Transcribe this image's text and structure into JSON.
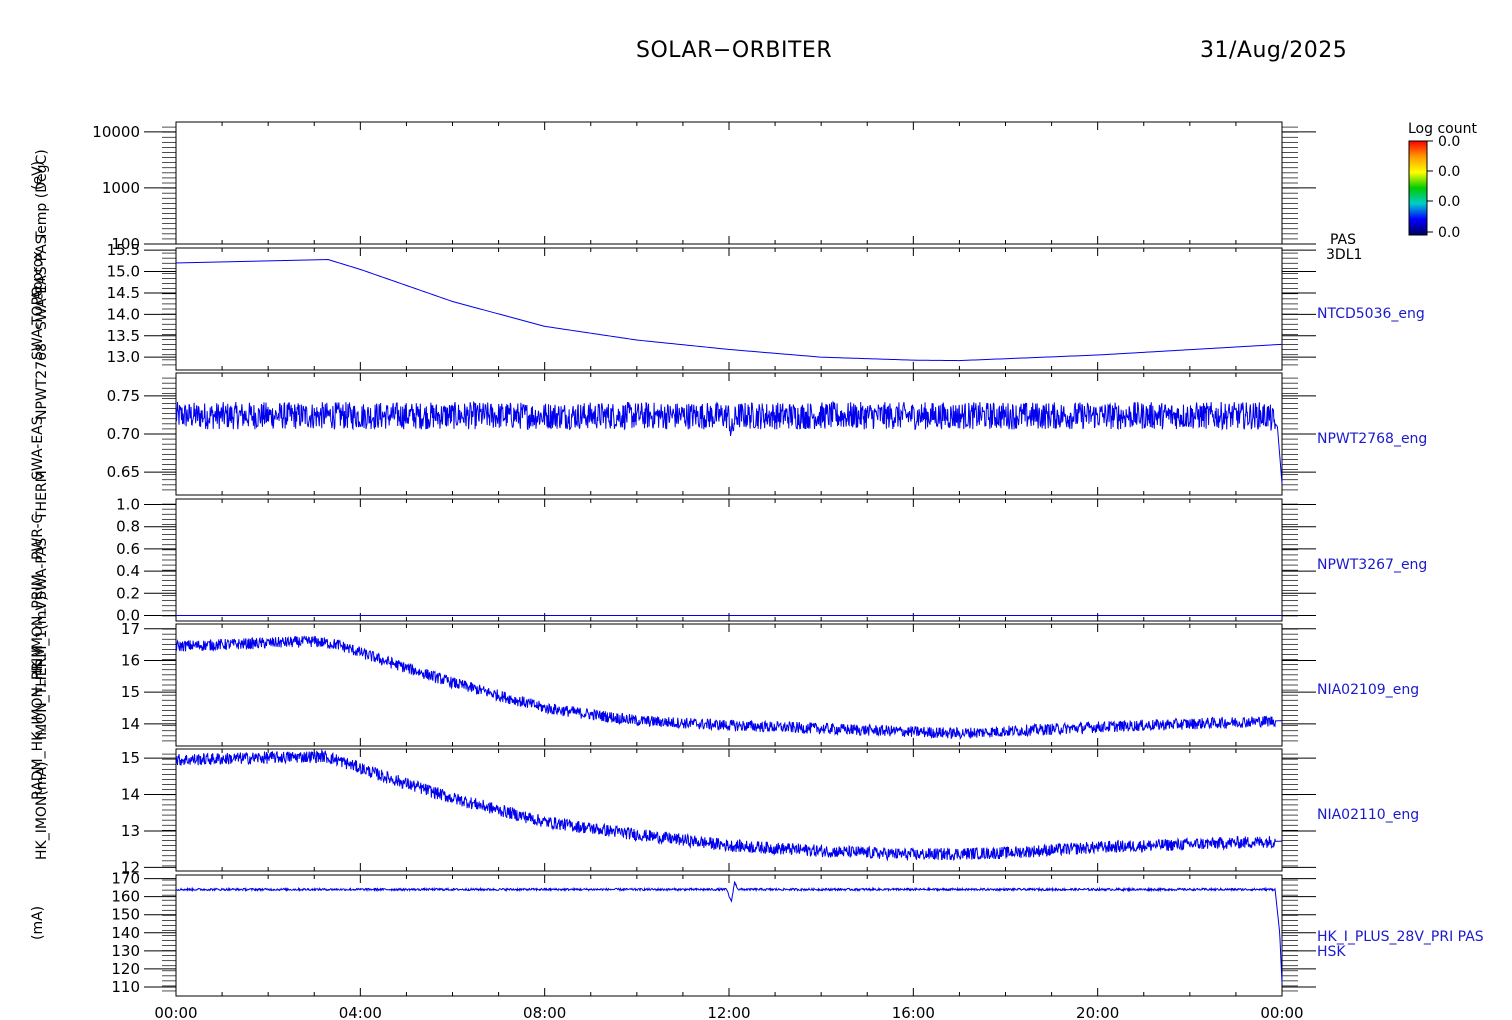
{
  "header": {
    "mission": "SOLAR−ORBITER",
    "date": "31/Aug/2025"
  },
  "y_axis_titles": [
    "(eV)",
    "Temp (DegC)",
    "Approx",
    "SWA-EAS-PAS",
    "SWA-TOPO",
    "NPWT2768",
    "SWA-EAS",
    "THERM",
    "PWR-C",
    "SWA-PAS",
    "HK_IMON_PRIM",
    "IMON_THERM_1(mV)",
    "RADM_HK_IMON_PRIM",
    "HK_IMON(mA)",
    "(mA)"
  ],
  "colorbar": {
    "title": "Log count",
    "ticks": [
      "0.0",
      "0.0",
      "0.0",
      "0.0"
    ],
    "colors": [
      "#ff0000",
      "#ff9900",
      "#ffff00",
      "#00cc00",
      "#00cccc",
      "#0000ff",
      "#000060"
    ]
  },
  "line_color": "#0000ee",
  "chart_data": {
    "type": "line",
    "x_ticks": [
      "00:00",
      "04:00",
      "08:00",
      "12:00",
      "16:00",
      "20:00",
      "00:00"
    ],
    "x_range_hours": [
      0,
      24
    ],
    "panels": [
      {
        "name": "PAS 3DL1",
        "label_lines": [
          "PAS",
          "3DL1"
        ],
        "type": "heatmap",
        "scale": "log",
        "ylim": [
          100,
          15000
        ],
        "yticks": [
          100,
          1000,
          10000
        ],
        "ytick_labels": [
          "100",
          "1000",
          "10000"
        ],
        "points": []
      },
      {
        "name": "NTCD5036_eng",
        "label_lines": [
          "NTCD5036_eng"
        ],
        "ylim": [
          12.7,
          15.55
        ],
        "yticks": [
          13.0,
          13.5,
          14.0,
          14.5,
          15.0,
          15.5
        ],
        "ytick_labels": [
          "13.0",
          "13.5",
          "14.0",
          "14.5",
          "15.0",
          "15.5"
        ],
        "noise": 0,
        "points": [
          [
            0,
            15.2
          ],
          [
            3.3,
            15.28
          ],
          [
            4,
            15.05
          ],
          [
            6,
            14.3
          ],
          [
            8,
            13.72
          ],
          [
            10,
            13.4
          ],
          [
            12,
            13.18
          ],
          [
            14,
            13.0
          ],
          [
            16,
            12.93
          ],
          [
            17,
            12.92
          ],
          [
            20,
            13.05
          ],
          [
            24,
            13.3
          ]
        ]
      },
      {
        "name": "NPWT2768_eng",
        "label_lines": [
          "NPWT2768_eng"
        ],
        "ylim": [
          0.62,
          0.78
        ],
        "yticks": [
          0.65,
          0.7,
          0.75
        ],
        "ytick_labels": [
          "0.65",
          "0.70",
          "0.75"
        ],
        "noise": 0.018,
        "points": [
          [
            0,
            0.724
          ],
          [
            12,
            0.724
          ],
          [
            12.05,
            0.7
          ],
          [
            12.15,
            0.724
          ],
          [
            23.7,
            0.724
          ],
          [
            23.9,
            0.71
          ],
          [
            24,
            0.635
          ]
        ]
      },
      {
        "name": "NPWT3267_eng",
        "label_lines": [
          "NPWT3267_eng"
        ],
        "ylim": [
          -0.05,
          1.05
        ],
        "yticks": [
          0.0,
          0.2,
          0.4,
          0.6,
          0.8,
          1.0
        ],
        "ytick_labels": [
          "0.0",
          "0.2",
          "0.4",
          "0.6",
          "0.8",
          "1.0"
        ],
        "noise": 0,
        "points": [
          [
            0,
            0.0
          ],
          [
            24,
            0.0
          ]
        ]
      },
      {
        "name": "NIA02109_eng",
        "label_lines": [
          "NIA02109_eng"
        ],
        "ylim": [
          13.3,
          17.15
        ],
        "yticks": [
          14,
          15,
          16,
          17
        ],
        "ytick_labels": [
          "14",
          "15",
          "16",
          "17"
        ],
        "noise": 0.18,
        "points": [
          [
            0,
            16.45
          ],
          [
            3,
            16.6
          ],
          [
            3.5,
            16.5
          ],
          [
            4.5,
            16.0
          ],
          [
            6,
            15.3
          ],
          [
            8,
            14.5
          ],
          [
            10,
            14.1
          ],
          [
            12,
            13.95
          ],
          [
            14,
            13.85
          ],
          [
            16,
            13.75
          ],
          [
            17,
            13.7
          ],
          [
            20,
            13.9
          ],
          [
            24,
            14.1
          ]
        ]
      },
      {
        "name": "NIA02110_eng",
        "label_lines": [
          "NIA02110_eng"
        ],
        "ylim": [
          11.9,
          15.25
        ],
        "yticks": [
          12,
          13,
          14,
          15
        ],
        "ytick_labels": [
          "12",
          "13",
          "14",
          "15"
        ],
        "noise": 0.17,
        "points": [
          [
            0,
            14.95
          ],
          [
            3.2,
            15.05
          ],
          [
            3.5,
            14.95
          ],
          [
            4.5,
            14.5
          ],
          [
            6,
            13.9
          ],
          [
            8,
            13.25
          ],
          [
            10,
            12.9
          ],
          [
            12,
            12.6
          ],
          [
            14,
            12.45
          ],
          [
            16,
            12.35
          ],
          [
            18,
            12.4
          ],
          [
            20,
            12.55
          ],
          [
            24,
            12.72
          ]
        ]
      },
      {
        "name": "HK_I_PLUS_28V_PRI PAS HSK",
        "label_lines": [
          "HK_I_PLUS_28V_PRI PAS",
          "HSK"
        ],
        "ylim": [
          105,
          172
        ],
        "yticks": [
          110,
          120,
          130,
          140,
          150,
          160,
          170
        ],
        "ytick_labels": [
          "110",
          "120",
          "130",
          "140",
          "150",
          "160",
          "170"
        ],
        "noise": 0.6,
        "points": [
          [
            0,
            164
          ],
          [
            11.95,
            164
          ],
          [
            12.05,
            157
          ],
          [
            12.12,
            168
          ],
          [
            12.2,
            164
          ],
          [
            23.85,
            164
          ],
          [
            23.95,
            140
          ],
          [
            24,
            112
          ]
        ]
      }
    ]
  }
}
